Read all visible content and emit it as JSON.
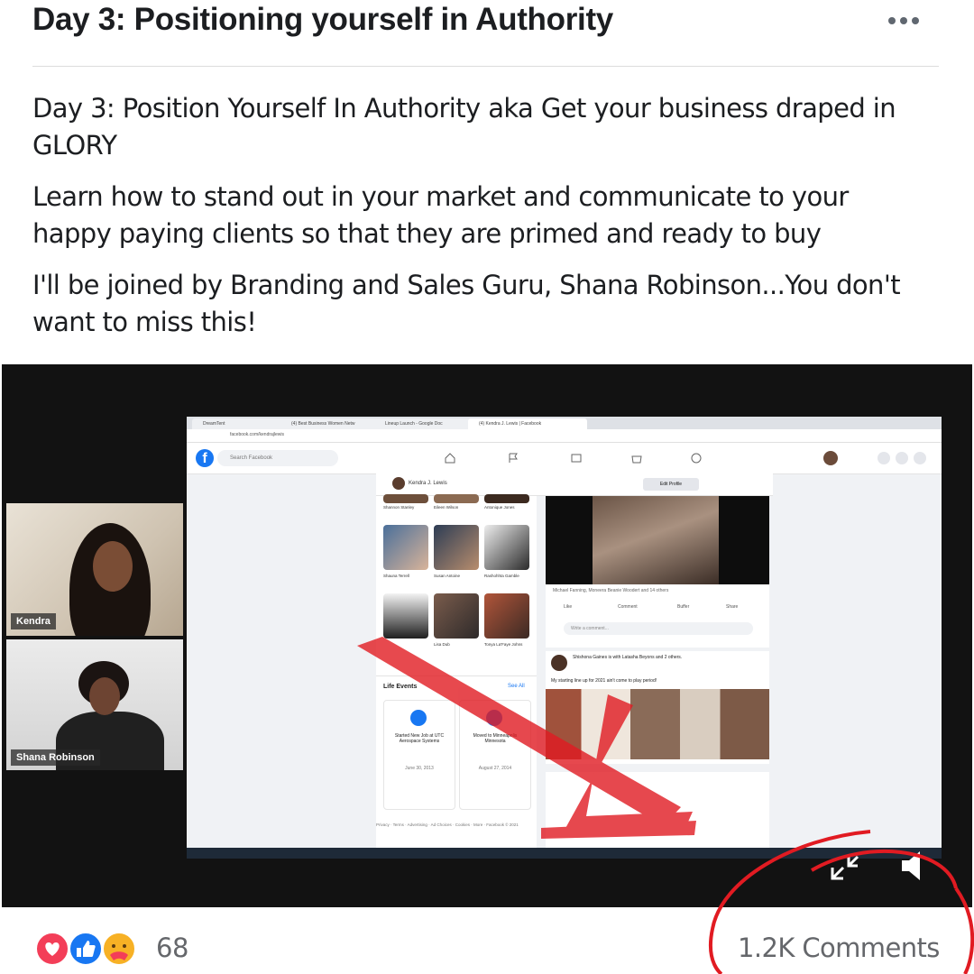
{
  "post": {
    "title": "Day 3: Positioning yourself in Authority",
    "paragraphs": [
      "Day 3: Position Yourself In Authority  aka Get your business draped in GLORY",
      "Learn how to stand out in your market and communicate to your happy paying clients so that they are primed and ready to buy",
      "I'll be joined by Branding and Sales Guru, Shana Robinson...You don't want to miss this!"
    ]
  },
  "video": {
    "participants": [
      {
        "name": "Kendra"
      },
      {
        "name": "Shana Robinson"
      }
    ],
    "shared_screen": {
      "tabs": [
        "DreamTent",
        "(4) Best Business Women Netw",
        "Lineup Launch - Google Doc",
        "(4) Kendra J. Lewis | Facebook"
      ],
      "url": "facebook.com/kendrajlewis",
      "search_placeholder": "Search Facebook",
      "profile_name": "Kendra J. Lewis",
      "edit_profile_label": "Edit Profile",
      "friends": [
        "Shannon Stanley",
        "Eileen Wilson",
        "Antonique Jones",
        "Shauna Terrell",
        "Susan Antoine",
        "Rashohhta Gamble",
        "",
        "Lisa Dub",
        "Tonya La'Faye Johns"
      ],
      "life_events_title": "Life Events",
      "see_all": "See All",
      "life_events": [
        {
          "text": "Started New Job at UTC Aerospace Systems",
          "date": "June 30, 2013"
        },
        {
          "text": "Moved to Minneapolis Minnesota",
          "date": "August 27, 2014"
        }
      ],
      "footer": "Privacy · Terms · Advertising · Ad Choices · Cookies · More · Facebook © 2021",
      "reactors": "Michael Fanning, Moneera Beanie Woodert and 14 others",
      "actions": [
        "Like",
        "Comment",
        "Buffer",
        "Share"
      ],
      "comment_placeholder": "Write a comment...",
      "post2_author": "Shishona Gaines is with Latasha Beyons and 2 others.",
      "post2_text": "My starting line up for 2021 ain't come to play period!"
    }
  },
  "footer": {
    "reaction_count": "68",
    "comments": "1.2K Comments"
  },
  "colors": {
    "fb_blue": "#1877f2",
    "meta_gray": "#65676b",
    "annotation_red": "#e11b22"
  },
  "icons": [
    "more-options-icon",
    "love-reaction-icon",
    "like-reaction-icon",
    "care-reaction-icon",
    "minimize-icon",
    "volume-icon"
  ]
}
